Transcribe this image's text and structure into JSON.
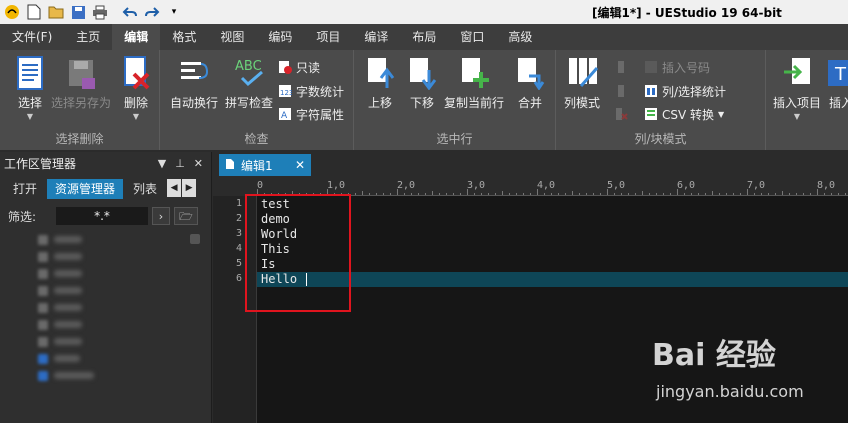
{
  "window": {
    "title": "[编辑1*] - UEStudio 19 64-bit"
  },
  "tabs": [
    {
      "label": "文件(F)",
      "active": false
    },
    {
      "label": "主页",
      "active": false
    },
    {
      "label": "编辑",
      "active": true
    },
    {
      "label": "格式",
      "active": false
    },
    {
      "label": "视图",
      "active": false
    },
    {
      "label": "编码",
      "active": false
    },
    {
      "label": "项目",
      "active": false
    },
    {
      "label": "编译",
      "active": false
    },
    {
      "label": "布局",
      "active": false
    },
    {
      "label": "窗口",
      "active": false
    },
    {
      "label": "高级",
      "active": false
    }
  ],
  "ribbon": {
    "groups": {
      "select_delete": "选择删除",
      "check": "检查",
      "select_line": "选中行",
      "column_block": "列/块模式"
    },
    "buttons": {
      "select": "选择",
      "select_save_as": "选择另存为",
      "delete": "删除",
      "auto_wrap": "自动换行",
      "spell_check": "拼写检查",
      "read_only": "只读",
      "word_count": "字数统计",
      "char_props": "字符属性",
      "move_up": "上移",
      "move_down": "下移",
      "duplicate_line": "复制当前行",
      "merge": "合并",
      "column_mode": "列模式",
      "insert_number": "插入号码",
      "column_select_stats": "列/选择统计",
      "csv_convert": "CSV 转换",
      "insert_item": "插入项目",
      "insert_truncated": "插入"
    }
  },
  "panel": {
    "title": "工作区管理器",
    "tabs": [
      "打开",
      "资源管理器",
      "列表"
    ],
    "filter_label": "筛选:",
    "filter_value": "*.*"
  },
  "editor": {
    "doc_tab": "编辑1",
    "ruler_labels": [
      "0",
      "1,0",
      "2,0",
      "3,0",
      "4,0",
      "5,0",
      "6,0",
      "7,0",
      "8,0"
    ],
    "line_numbers": [
      "1",
      "2",
      "3",
      "4",
      "5",
      "6"
    ],
    "lines": [
      "test",
      "demo",
      "World",
      "This",
      "Is",
      "Hello "
    ],
    "current_line": 6
  },
  "watermark": {
    "main": "Bai 经验",
    "sub": "jingyan.baidu.com"
  },
  "colors": {
    "accent": "#1e7fb8",
    "highlight_line": "#0e4657",
    "annotation_box": "#e0141e"
  }
}
